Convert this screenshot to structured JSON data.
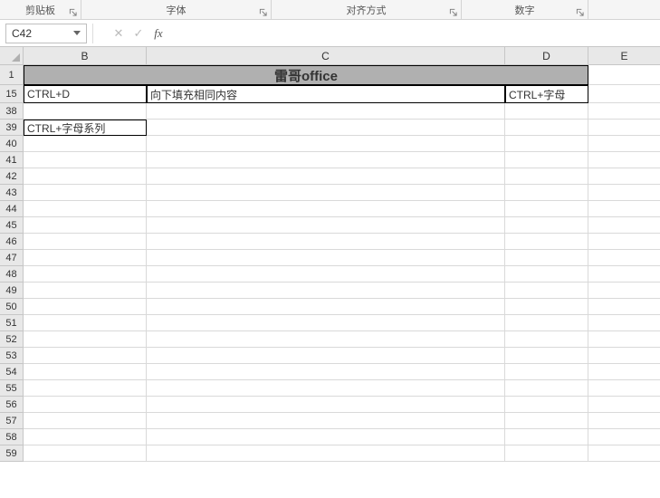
{
  "ribbon": {
    "clipboard": "剪贴板",
    "font": "字体",
    "alignment": "对齐方式",
    "number": "数字"
  },
  "namebox": {
    "ref": "C42"
  },
  "fx": {
    "cancel": "✕",
    "confirm": "✓",
    "label": "fx"
  },
  "columns": [
    "B",
    "C",
    "D",
    "E"
  ],
  "rows_header": [
    "1",
    "15",
    "38",
    "39",
    "40",
    "41",
    "42",
    "43",
    "44",
    "45",
    "46",
    "47",
    "48",
    "49",
    "50",
    "51",
    "52",
    "53",
    "54",
    "55",
    "56",
    "57",
    "58",
    "59"
  ],
  "title_row": {
    "text": "雷哥office"
  },
  "row15": {
    "b": "CTRL+D",
    "c": "向下填充相同内容",
    "d": "CTRL+字母"
  },
  "row39": {
    "b": "CTRL+字母系列"
  }
}
